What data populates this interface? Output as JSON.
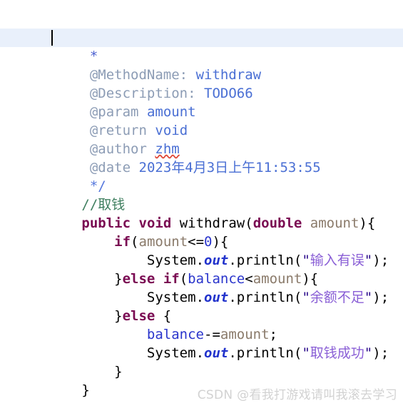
{
  "editor": {
    "background_color": "#ffffff",
    "current_line_highlight_color": "#e9f0fb",
    "caret_color": "#000000",
    "font_size_px": 19,
    "line_height_px": 26
  },
  "theme": {
    "keyword_color": "#7a0a52",
    "comment_color": "#3f7f5f",
    "javadoc_tag_color": "#8c9cb5",
    "javadoc_value_color": "#4a6fd4",
    "javadoc_delimiter_color": "#5577dd",
    "field_color": "#2a35cc",
    "static_member_color": "#2233cc",
    "parameter_color": "#8a7a6a",
    "string_color": "#2a0a8a",
    "string_cjk_color": "#8a5fd6",
    "plain_color": "#000000",
    "spellcheck_underline_color": "#e04a3a",
    "watermark_color": "#d2d2d2"
  },
  "code": {
    "lines": [
      {
        "id": "line-close-brace-top",
        "text": "    }"
      },
      {
        "id": "line-javadoc-open",
        "text": "    /**"
      },
      {
        "id": "line-javadoc-caret",
        "text": "     * "
      },
      {
        "id": "line-javadoc-methodname",
        "text": "     @MethodName: withdraw"
      },
      {
        "id": "line-javadoc-description",
        "text": "     @Description: TODO66"
      },
      {
        "id": "line-javadoc-param",
        "text": "     @param amount"
      },
      {
        "id": "line-javadoc-return",
        "text": "     @return void"
      },
      {
        "id": "line-javadoc-author",
        "text": "     @author zhm"
      },
      {
        "id": "line-javadoc-date",
        "text": "     @date 2023年4月3日上午11:53:55"
      },
      {
        "id": "line-javadoc-close",
        "text": "     */"
      },
      {
        "id": "line-comment-withdraw",
        "text": "    //取钱"
      },
      {
        "id": "line-method-signature",
        "text": "    public void withdraw(double amount){"
      },
      {
        "id": "line-if-amount",
        "text": "        if(amount<=0){"
      },
      {
        "id": "line-print-invalid-input",
        "text": "            System.out.println(\"输入有误\");"
      },
      {
        "id": "line-else-if-balance",
        "text": "        }else if(balance<amount){"
      },
      {
        "id": "line-print-insufficient",
        "text": "            System.out.println(\"余额不足\");"
      },
      {
        "id": "line-else",
        "text": "        }else {"
      },
      {
        "id": "line-balance-subtract",
        "text": "            balance-=amount;"
      },
      {
        "id": "line-print-success",
        "text": "            System.out.println(\"取钱成功\");"
      },
      {
        "id": "line-close-inner",
        "text": "        }"
      },
      {
        "id": "line-close-method",
        "text": "    }"
      }
    ],
    "javadoc": {
      "method_name_tag": "@MethodName:",
      "method_name_value": "withdraw",
      "description_tag": "@Description:",
      "description_value": "TODO66",
      "param_tag": "@param",
      "param_value": "amount",
      "return_tag": "@return",
      "return_value": "void",
      "author_tag": "@author",
      "author_value": "zhm",
      "date_tag": "@date",
      "date_value": "2023年4月3日上午11:53:55",
      "open_delimiter": "/**",
      "star": "*",
      "close_delimiter": "*/"
    },
    "strings": {
      "invalid_input": "输入有误",
      "insufficient_balance": "余额不足",
      "withdraw_success": "取钱成功"
    },
    "comment_withdraw": "//取钱",
    "identifiers": {
      "method": "withdraw",
      "parameter": "amount",
      "field": "balance",
      "class": "System",
      "static_member": "out",
      "method_call": "println"
    },
    "keywords": [
      "public",
      "void",
      "double",
      "if",
      "else"
    ]
  },
  "watermark": {
    "text": "CSDN @看我打游戏请叫我滚去学习"
  }
}
